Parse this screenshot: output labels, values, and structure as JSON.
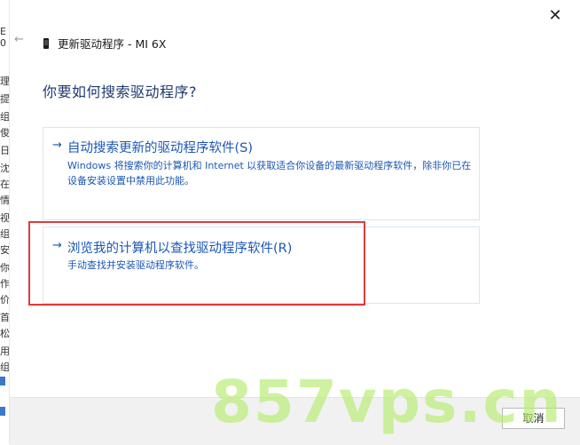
{
  "background_window": {
    "glyphs": [
      "E",
      "0",
      "理",
      "提",
      "组",
      "俊",
      "日",
      "沈",
      "在",
      "情",
      "视",
      "组",
      "安",
      "你",
      "作",
      "价",
      "首",
      "松",
      "用",
      "组"
    ]
  },
  "dialog": {
    "title": "更新驱动程序 - MI 6X",
    "heading": "你要如何搜索驱动程序?",
    "options": [
      {
        "arrow": "→",
        "title": "自动搜索更新的驱动程序软件(S)",
        "description": "Windows 将搜索你的计算机和 Internet 以获取适合你设备的最新驱动程序软件，除非你已在设备安装设置中禁用此功能。"
      },
      {
        "arrow": "→",
        "title": "浏览我的计算机以查找驱动程序软件(R)",
        "description": "手动查找并安装驱动程序软件。"
      }
    ],
    "close_symbol": "✕",
    "back_symbol": "←",
    "cancel_label": "取消"
  },
  "watermark": "857vps.cn",
  "colors": {
    "link_blue": "#1b57b4",
    "heading_blue": "#1f3a6e",
    "highlight_red": "#e03a3a",
    "option_border": "#d9e6f2"
  }
}
